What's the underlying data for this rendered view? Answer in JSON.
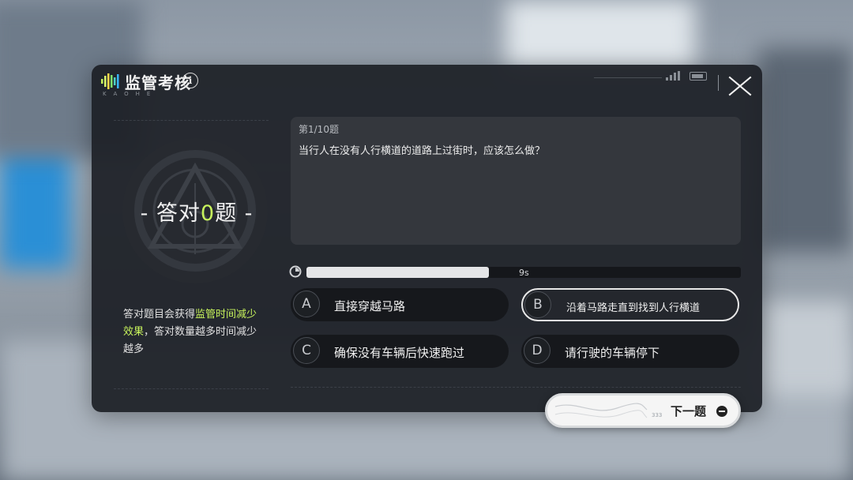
{
  "header": {
    "title": "监管考核",
    "subtitle": "KAOHE",
    "info_symbol": "i"
  },
  "left": {
    "score_prefix": "- 答对",
    "score_value": "0",
    "score_suffix": "题 -",
    "desc_part1": "答对题目会获得",
    "desc_highlight1": "监管时间减少",
    "desc_highlight2": "效果",
    "desc_part2": "，答对数量越多时间减少越多"
  },
  "question": {
    "counter": "第1/10题",
    "text": "当行人在没有人行横道的道路上过街时，应该怎么做？"
  },
  "timer": {
    "label": "9s",
    "progress": 0.42
  },
  "options": [
    {
      "letter": "A",
      "text": "直接穿越马路",
      "selected": false
    },
    {
      "letter": "B",
      "text": "沿着马路走直到找到人行横道",
      "selected": true
    },
    {
      "letter": "C",
      "text": "确保没有车辆后快速跑过",
      "selected": false
    },
    {
      "letter": "D",
      "text": "请行驶的车辆停下",
      "selected": false
    }
  ],
  "next_button": {
    "small_text": "333",
    "label": "下一题"
  },
  "colors": {
    "accent": "#c7f35c",
    "panel": "#1e2127"
  }
}
